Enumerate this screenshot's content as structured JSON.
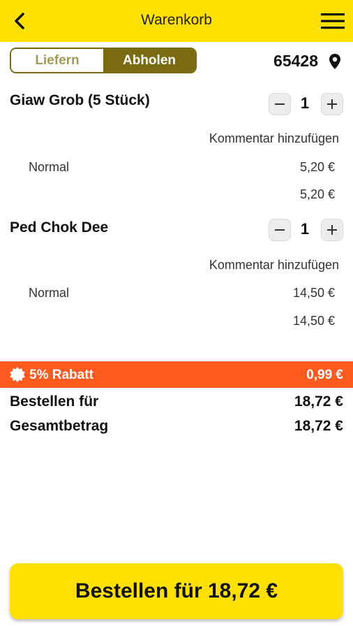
{
  "header": {
    "title": "Warenkorb"
  },
  "delivery_toggle": {
    "deliver_label": "Liefern",
    "pickup_label": "Abholen",
    "active": "Abholen"
  },
  "location": {
    "zip": "65428"
  },
  "items": [
    {
      "name": "Giaw Grob (5 Stück)",
      "quantity": "1",
      "comment_label": "Kommentar hinzufügen",
      "variant": "Normal",
      "variant_price": "5,20 €",
      "total": "5,20 €"
    },
    {
      "name": "Ped Chok Dee",
      "quantity": "1",
      "comment_label": "Kommentar hinzufügen",
      "variant": "Normal",
      "variant_price": "14,50 €",
      "total": "14,50 €"
    }
  ],
  "discount": {
    "label": "5% Rabatt",
    "value": "0,99 €",
    "color": "#ff5a1f"
  },
  "summary": {
    "order_for_label": "Bestellen für",
    "order_for_value": "18,72 €",
    "total_label": "Gesamtbetrag",
    "total_value": "18,72 €"
  },
  "order_button": {
    "label": "Bestellen für 18,72 €"
  },
  "colors": {
    "brand": "#ffe000",
    "toggle_active": "#7a6a10"
  }
}
